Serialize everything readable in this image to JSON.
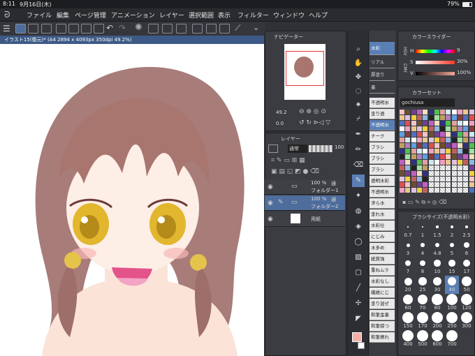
{
  "status": {
    "time": "8:11",
    "date": "9月16日(木)",
    "battery": "79%"
  },
  "menu": [
    "ファイル",
    "編集",
    "ページ管理",
    "アニメーション",
    "レイヤー",
    "選択範囲",
    "表示",
    "フィルター",
    "ウィンドウ",
    "ヘルプ"
  ],
  "document": {
    "tab": "イラスト15(復元)* (A4 2894 x 4093px 350dpi 49.2%)"
  },
  "navigator": {
    "title": "ナビゲーター",
    "zoom": "49.2",
    "angle": "0.0"
  },
  "layer": {
    "title": "レイヤー",
    "blend": "通常",
    "opacity": "100",
    "rows": [
      {
        "pct": "100 %",
        "mode": "通",
        "name": "フォルダー1"
      },
      {
        "pct": "100 %",
        "mode": "通",
        "name": "フォルダー2"
      },
      {
        "pct": "",
        "mode": "",
        "name": "用紙"
      }
    ]
  },
  "color_slider": {
    "title": "カラースライダー",
    "h_label": "H",
    "h": "9",
    "s_label": "S",
    "s": "30%",
    "v_label": "V",
    "v": "100%",
    "mode_labels": [
      "HSV",
      "CMY"
    ]
  },
  "color_set": {
    "title": "カラーセット",
    "set_name": "gochiusa"
  },
  "brush_size": {
    "title": "ブラシサイズ(不透明水彩)",
    "sizes": [
      "0.7",
      "1",
      "1.5",
      "2",
      "2.5",
      "3",
      "4",
      "4.8",
      "5",
      "6",
      "7",
      "8",
      "10",
      "15",
      "17",
      "20",
      "25",
      "30",
      "40",
      "50",
      "60",
      "70",
      "80",
      "100",
      "120",
      "150",
      "170",
      "200",
      "250",
      "300",
      "400",
      "500",
      "600",
      "700"
    ]
  },
  "subtools": {
    "top": [
      "水彩",
      "リアル",
      "厚塗り",
      "墨"
    ],
    "list": [
      "不透明水",
      "塗り透",
      "不透明水",
      "チーク",
      "ブラシ",
      "ブラシ",
      "ブラシ",
      "透明水彩",
      "不透明水",
      "滲ら水",
      "塗れ水",
      "水彩仕",
      "にじみ",
      "水多め",
      "紙質強",
      "重ねムラ",
      "水彩なし",
      "繊維にじ",
      "塗り混ぜ",
      "和筆金墨",
      "和筆掠つ",
      "和筆擦れ"
    ]
  },
  "colors": {
    "accent": "#5a7fb5",
    "drawing_color": "#f2b0a8",
    "hair": "#8a5c58"
  }
}
